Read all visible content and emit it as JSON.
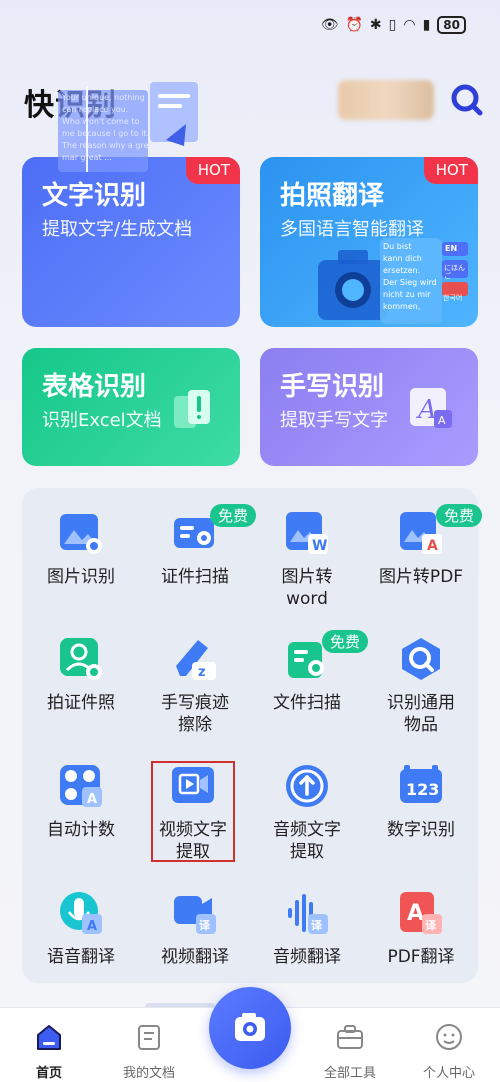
{
  "status_bar": {
    "battery": "80"
  },
  "header": {
    "title": "快识别"
  },
  "cards": [
    {
      "title": "文字识别",
      "sub": "提取文字/生成文档",
      "badge": "HOT"
    },
    {
      "title": "拍照翻译",
      "sub": "多国语言智能翻译",
      "badge": "HOT"
    },
    {
      "title": "表格识别",
      "sub": "识别Excel文档"
    },
    {
      "title": "手写识别",
      "sub": "提取手写文字"
    }
  ],
  "ocr_sample": [
    "Your unique, nothing",
    "can replace you.",
    "Who won't come to",
    "me because I go to it.",
    "The reason why a great",
    "mar great ..."
  ],
  "translate_sample": [
    "Du bist",
    "kann dich",
    "ersetzen.",
    "Der Sieg wird",
    "nicht zu mir",
    "kommen,"
  ],
  "lang_tags": [
    "EN",
    "にほんご",
    "한국어"
  ],
  "tools": [
    {
      "label": "图片识别",
      "icon": "image-recognize-icon"
    },
    {
      "label": "证件扫描",
      "icon": "id-scan-icon",
      "badge": "免费"
    },
    {
      "label": "图片转word",
      "icon": "image-to-word-icon"
    },
    {
      "label": "图片转PDF",
      "icon": "image-to-pdf-icon",
      "badge": "免费"
    },
    {
      "label": "拍证件照",
      "icon": "id-photo-icon"
    },
    {
      "label": "手写痕迹擦除",
      "icon": "handwriting-erase-icon"
    },
    {
      "label": "文件扫描",
      "icon": "file-scan-icon",
      "badge": "免费"
    },
    {
      "label": "识别通用物品",
      "icon": "object-recognize-icon"
    },
    {
      "label": "自动计数",
      "icon": "auto-count-icon"
    },
    {
      "label": "视频文字提取",
      "icon": "video-text-icon"
    },
    {
      "label": "音频文字提取",
      "icon": "audio-text-icon"
    },
    {
      "label": "数字识别",
      "icon": "number-recognize-icon"
    },
    {
      "label": "语音翻译",
      "icon": "voice-translate-icon"
    },
    {
      "label": "视频翻译",
      "icon": "video-translate-icon"
    },
    {
      "label": "音频翻译",
      "icon": "audio-translate-icon"
    },
    {
      "label": "PDF翻译",
      "icon": "pdf-translate-icon"
    }
  ],
  "tool_labels_wrapped": {
    "2": [
      "图片转",
      "word"
    ],
    "5": [
      "手写痕迹",
      "擦除"
    ],
    "7": [
      "识别通用",
      "物品"
    ],
    "9": [
      "视频文字",
      "提取"
    ],
    "10": [
      "音频文字",
      "提取"
    ]
  },
  "nav": [
    {
      "label": "首页",
      "icon": "home-icon",
      "active": true
    },
    {
      "label": "我的文档",
      "icon": "documents-icon"
    },
    {
      "label": "全部工具",
      "icon": "toolbox-icon"
    },
    {
      "label": "个人中心",
      "icon": "profile-icon"
    }
  ],
  "colors": {
    "primary": "#4d6ef5",
    "hot": "#f2344a",
    "free": "#19c58c",
    "highlight": "#d0312f"
  }
}
